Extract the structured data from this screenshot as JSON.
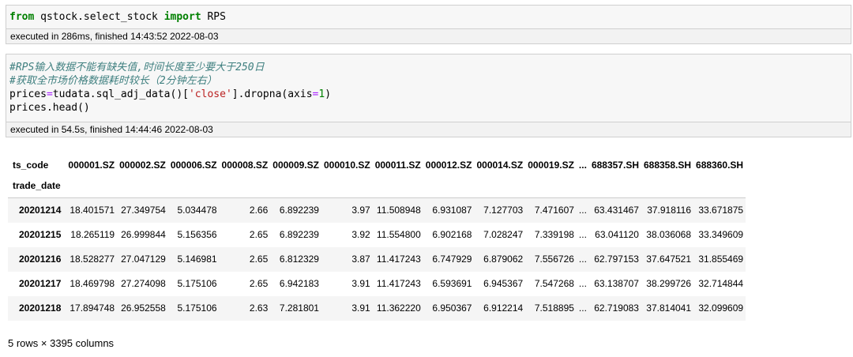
{
  "cell1": {
    "code": {
      "kw1": "from",
      "mod": "qstock.select_stock",
      "kw2": "import",
      "name": "RPS"
    },
    "exec": "executed in 286ms, finished 14:43:52 2022-08-03"
  },
  "cell2": {
    "comment1": "#RPS输入数据不能有缺失值,时间长度至少要大于250日",
    "comment2": "#获取全市场价格数据耗时较长（2分钟左右）",
    "line3": {
      "lhs": "prices",
      "eq": "=",
      "call": "tudata.sql_adj_data()[",
      "str": "'close'",
      "rest1": "].dropna(axis",
      "eq2": "=",
      "num": "1",
      "rest2": ")"
    },
    "line4": "prices.head()",
    "exec": "executed in 54.5s, finished 14:44:46 2022-08-03"
  },
  "table": {
    "columns_label": "ts_code",
    "index_label": "trade_date",
    "columns": [
      "000001.SZ",
      "000002.SZ",
      "000006.SZ",
      "000008.SZ",
      "000009.SZ",
      "000010.SZ",
      "000011.SZ",
      "000012.SZ",
      "000014.SZ",
      "000019.SZ",
      "...",
      "688357.SH",
      "688358.SH",
      "688360.SH"
    ],
    "rows": [
      {
        "index": "20201214",
        "values": [
          "18.401571",
          "27.349754",
          "5.034478",
          "2.66",
          "6.892239",
          "3.97",
          "11.508948",
          "6.931087",
          "7.127703",
          "7.471607",
          "...",
          "63.431467",
          "37.918116",
          "33.671875"
        ]
      },
      {
        "index": "20201215",
        "values": [
          "18.265119",
          "26.999844",
          "5.156356",
          "2.65",
          "6.892239",
          "3.92",
          "11.554800",
          "6.902168",
          "7.028247",
          "7.339198",
          "...",
          "63.041120",
          "38.036068",
          "33.349609"
        ]
      },
      {
        "index": "20201216",
        "values": [
          "18.528277",
          "27.047129",
          "5.146981",
          "2.65",
          "6.812329",
          "3.87",
          "11.417243",
          "6.747929",
          "6.879062",
          "7.556726",
          "...",
          "62.797153",
          "37.647521",
          "31.855469"
        ]
      },
      {
        "index": "20201217",
        "values": [
          "18.469798",
          "27.274098",
          "5.175106",
          "2.65",
          "6.942183",
          "3.91",
          "11.417243",
          "6.593691",
          "6.945367",
          "7.547268",
          "...",
          "63.138707",
          "38.299726",
          "32.714844"
        ]
      },
      {
        "index": "20201218",
        "values": [
          "17.894748",
          "26.952558",
          "5.175106",
          "2.63",
          "7.281801",
          "3.91",
          "11.362220",
          "6.950367",
          "6.912214",
          "7.518895",
          "...",
          "62.719083",
          "37.814041",
          "32.099609"
        ]
      }
    ],
    "footer": "5 rows × 3395 columns"
  }
}
